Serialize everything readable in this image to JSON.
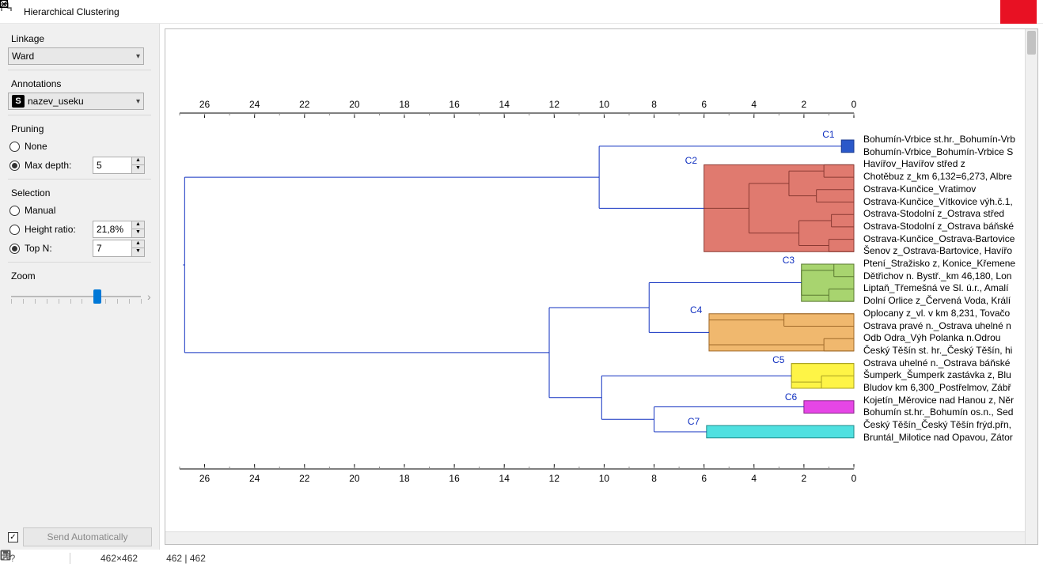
{
  "window": {
    "title": "Hierarchical Clustering"
  },
  "sidebar": {
    "linkage_label": "Linkage",
    "linkage_value": "Ward",
    "annotations_label": "Annotations",
    "annotations_value": "nazev_useku",
    "pruning_label": "Pruning",
    "pruning_none": "None",
    "pruning_maxdepth": "Max depth:",
    "pruning_maxdepth_value": "5",
    "selection_label": "Selection",
    "selection_manual": "Manual",
    "selection_heightratio": "Height ratio:",
    "selection_heightratio_value": "21,8%",
    "selection_topn": "Top N:",
    "selection_topn_value": "7",
    "zoom_label": "Zoom",
    "send_auto": "Send Automatically"
  },
  "status": {
    "dims": "462×462",
    "flow": "462 | 462"
  },
  "chart_data": {
    "type": "dendrogram",
    "orientation": "right",
    "x_axis_label": "",
    "x_ticks": [
      26,
      24,
      22,
      20,
      18,
      16,
      14,
      12,
      10,
      8,
      6,
      4,
      2,
      0
    ],
    "x_range": [
      27,
      0
    ],
    "clusters": [
      {
        "id": "C1",
        "height": 0.5,
        "color": "#2a58c9",
        "members": [
          0,
          1
        ]
      },
      {
        "id": "C2",
        "height": 6.0,
        "color": "#e07a6f",
        "members": [
          2,
          3,
          4,
          5,
          6,
          7,
          8,
          9
        ]
      },
      {
        "id": "C3",
        "height": 2.1,
        "color": "#a8d46f",
        "members": [
          10,
          11,
          12,
          13
        ]
      },
      {
        "id": "C4",
        "height": 5.8,
        "color": "#f0b86e",
        "members": [
          14,
          15,
          16,
          17
        ]
      },
      {
        "id": "C5",
        "height": 2.5,
        "color": "#fef446",
        "members": [
          18,
          19,
          20
        ]
      },
      {
        "id": "C6",
        "height": 2.0,
        "color": "#e646e6",
        "members": [
          21,
          22
        ]
      },
      {
        "id": "C7",
        "height": 5.9,
        "color": "#4fe0e0",
        "members": [
          23,
          24
        ]
      },
      {
        "root": true,
        "height": 26.8
      }
    ],
    "merges": [
      {
        "left": "C1",
        "right": "C2",
        "height": 10.2
      },
      {
        "left": "C3",
        "right": "C4",
        "height": 8.2
      },
      {
        "left": "C6",
        "right": "C7",
        "height": 8.0
      },
      {
        "left": "C5",
        "right": "(C6,C7)",
        "height": 10.1
      },
      {
        "left": "(C3,C4)",
        "right": "(C5,C6,C7)",
        "height": 12.2
      },
      {
        "left": "(C1,C2)",
        "right": "rest",
        "height": 26.8
      }
    ],
    "leaves": [
      "Bohumín-Vrbice st.hr._Bohumín-Vrb",
      "Bohumín-Vrbice_Bohumín-Vrbice S",
      "Havířov_Havířov střed z",
      "Chotěbuz z_km 6,132=6,273, Albre",
      "Ostrava-Kunčice_Vratimov",
      "Ostrava-Kunčice_Vítkovice výh.č.1,",
      "Ostrava-Stodolní z_Ostrava střed",
      "Ostrava-Stodolní z_Ostrava báňské",
      "Ostrava-Kunčice_Ostrava-Bartovice",
      "Šenov z_Ostrava-Bartovice, Havířo",
      "Ptení_Stražisko z, Konice_Křemene",
      "Dětřichov n. Bystř._km 46,180, Lon",
      "Liptaň_Třemešná ve Sl. ú.r., Amalí",
      "Dolní Orlice z_Červená Voda, Králí",
      "Oplocany z_vl. v km 8,231, Tovačo",
      "Ostrava pravé n._Ostrava uhelné n",
      "Odb Odra_Výh Polanka n.Odrou",
      "Český Těšín st. hr._Český Těšín, hi",
      "Ostrava uhelné n._Ostrava báňské",
      "Šumperk_Šumperk zastávka z, Blu",
      "Bludov km 6,300_Postřelmov, Zábř",
      "Kojetín_Měrovice nad Hanou z, Něr",
      "Bohumín st.hr._Bohumín os.n., Sed",
      "Český Těšín_Český Těšín frýd.přn,",
      "Bruntál_Milotice nad Opavou, Zátor"
    ]
  }
}
